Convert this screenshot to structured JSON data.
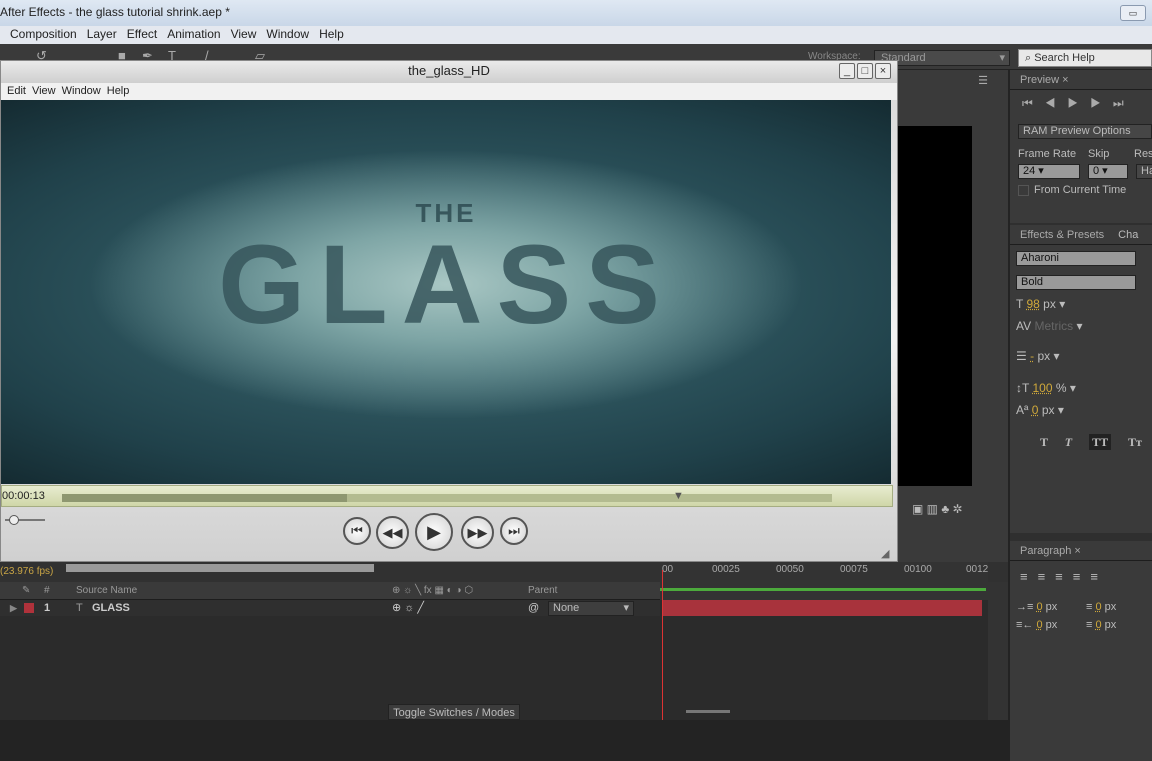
{
  "app": {
    "title": "After Effects - the glass tutorial shrink.aep *"
  },
  "menu": [
    "Composition",
    "Layer",
    "Effect",
    "Animation",
    "View",
    "Window",
    "Help"
  ],
  "toolbar": {
    "workspace_label": "Workspace:",
    "workspace": "Standard",
    "search_placeholder": "Search Help"
  },
  "player": {
    "title": "the_glass_HD",
    "menu": [
      "Edit",
      "View",
      "Window",
      "Help"
    ],
    "video_text_small": "THE",
    "video_text_large": "GLASS",
    "timecode": "00:00:13",
    "progress": 0.37,
    "playhead": 0.8
  },
  "preview": {
    "tab": "Preview",
    "ram_options": "RAM Preview Options",
    "frame_rate_label": "Frame Rate",
    "frame_rate": "24",
    "skip_label": "Skip",
    "skip": "0",
    "res_label": "Res",
    "res": "Ha",
    "from_current": "From Current Time"
  },
  "effects": {
    "tab": "Effects & Presets",
    "char_tab": "Cha",
    "font": "Aharoni",
    "style": "Bold",
    "size": "98",
    "size_unit": "px",
    "kerning": "Metrics",
    "leading": "-",
    "leading_unit": "px",
    "vscale": "100",
    "vscale_unit": "%",
    "baseline": "0",
    "baseline_unit": "px",
    "styles": [
      "T",
      "T",
      "TT",
      "Tт"
    ]
  },
  "paragraph": {
    "tab": "Paragraph",
    "indent": [
      "0",
      "0",
      "0",
      "0"
    ],
    "unit": "px"
  },
  "timeline": {
    "fps": "(23.976 fps)",
    "columns": {
      "num": "#",
      "source": "Source Name",
      "parent": "Parent"
    },
    "ticks": [
      "00",
      "00025",
      "00050",
      "00075",
      "00100",
      "0012"
    ],
    "layers": [
      {
        "num": "1",
        "name": "GLASS",
        "parent": "None"
      }
    ],
    "toggle": "Toggle Switches / Modes",
    "layer_color": "#a8333c"
  }
}
